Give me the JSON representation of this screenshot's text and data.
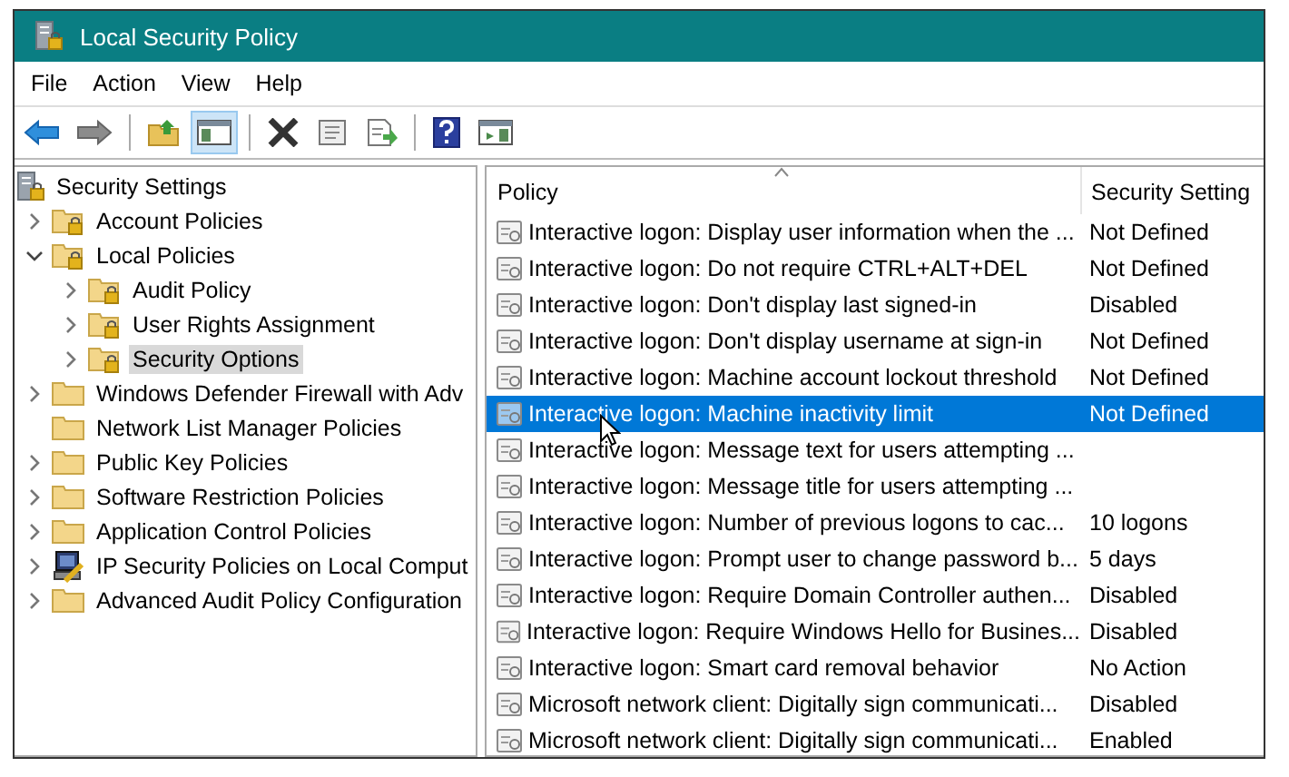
{
  "window": {
    "title": "Local Security Policy"
  },
  "menu": [
    "File",
    "Action",
    "View",
    "Help"
  ],
  "toolbar": [
    {
      "kind": "back",
      "pressed": false
    },
    {
      "kind": "forward",
      "pressed": false
    },
    {
      "kind": "separator"
    },
    {
      "kind": "up",
      "pressed": false
    },
    {
      "kind": "tree",
      "pressed": true
    },
    {
      "kind": "separator"
    },
    {
      "kind": "delete",
      "pressed": false
    },
    {
      "kind": "properties",
      "pressed": false
    },
    {
      "kind": "export",
      "pressed": false
    },
    {
      "kind": "separator"
    },
    {
      "kind": "help",
      "pressed": false
    },
    {
      "kind": "pane",
      "pressed": false
    }
  ],
  "tree": [
    {
      "label": "Security Settings",
      "kind": "root",
      "selected": false,
      "children": [
        {
          "label": "Account Policies",
          "kind": "lockfolder",
          "expanded": false,
          "selected": false
        },
        {
          "label": "Local Policies",
          "kind": "lockfolder",
          "expanded": true,
          "selected": false,
          "children": [
            {
              "label": "Audit Policy",
              "kind": "lockfolder",
              "expanded": false,
              "selected": false
            },
            {
              "label": "User Rights Assignment",
              "kind": "lockfolder",
              "expanded": false,
              "selected": false
            },
            {
              "label": "Security Options",
              "kind": "lockfolder",
              "expanded": false,
              "selected": true
            }
          ]
        },
        {
          "label": "Windows Defender Firewall with Adv",
          "kind": "folder",
          "expanded": false,
          "selected": false
        },
        {
          "label": "Network List Manager Policies",
          "kind": "folder",
          "selected": false
        },
        {
          "label": "Public Key Policies",
          "kind": "folder",
          "expanded": false,
          "selected": false
        },
        {
          "label": "Software Restriction Policies",
          "kind": "folder",
          "expanded": false,
          "selected": false
        },
        {
          "label": "Application Control Policies",
          "kind": "folder",
          "expanded": false,
          "selected": false
        },
        {
          "label": "IP Security Policies on Local Comput",
          "kind": "computer",
          "expanded": false,
          "selected": false
        },
        {
          "label": "Advanced Audit Policy Configuration",
          "kind": "folder",
          "expanded": false,
          "selected": false
        }
      ]
    }
  ],
  "table": {
    "columns": [
      {
        "label": "Policy",
        "sorted": true
      },
      {
        "label": "Security Setting",
        "sorted": false
      }
    ],
    "rows": [
      {
        "policy": "Interactive logon: Display user information when the ...",
        "setting": "Not Defined",
        "selected": false
      },
      {
        "policy": "Interactive logon: Do not require CTRL+ALT+DEL",
        "setting": "Not Defined",
        "selected": false
      },
      {
        "policy": "Interactive logon: Don't display last signed-in",
        "setting": "Disabled",
        "selected": false
      },
      {
        "policy": "Interactive logon: Don't display username at sign-in",
        "setting": "Not Defined",
        "selected": false
      },
      {
        "policy": "Interactive logon: Machine account lockout threshold",
        "setting": "Not Defined",
        "selected": false
      },
      {
        "policy": "Interactive logon: Machine inactivity limit",
        "setting": "Not Defined",
        "selected": true
      },
      {
        "policy": "Interactive logon: Message text for users attempting ...",
        "selected": false
      },
      {
        "policy": "Interactive logon: Message title for users attempting ...",
        "selected": false
      },
      {
        "policy": "Interactive logon: Number of previous logons to cac...",
        "setting": "10 logons",
        "selected": false
      },
      {
        "policy": "Interactive logon: Prompt user to change password b...",
        "setting": "5 days",
        "selected": false
      },
      {
        "policy": "Interactive logon: Require Domain Controller authen...",
        "setting": "Disabled",
        "selected": false
      },
      {
        "policy": "Interactive logon: Require Windows Hello for Busines...",
        "setting": "Disabled",
        "selected": false
      },
      {
        "policy": "Interactive logon: Smart card removal behavior",
        "setting": "No Action",
        "selected": false
      },
      {
        "policy": "Microsoft network client: Digitally sign communicati...",
        "setting": "Disabled",
        "selected": false
      },
      {
        "policy": "Microsoft network client: Digitally sign communicati...",
        "setting": "Enabled",
        "selected": false
      }
    ]
  }
}
